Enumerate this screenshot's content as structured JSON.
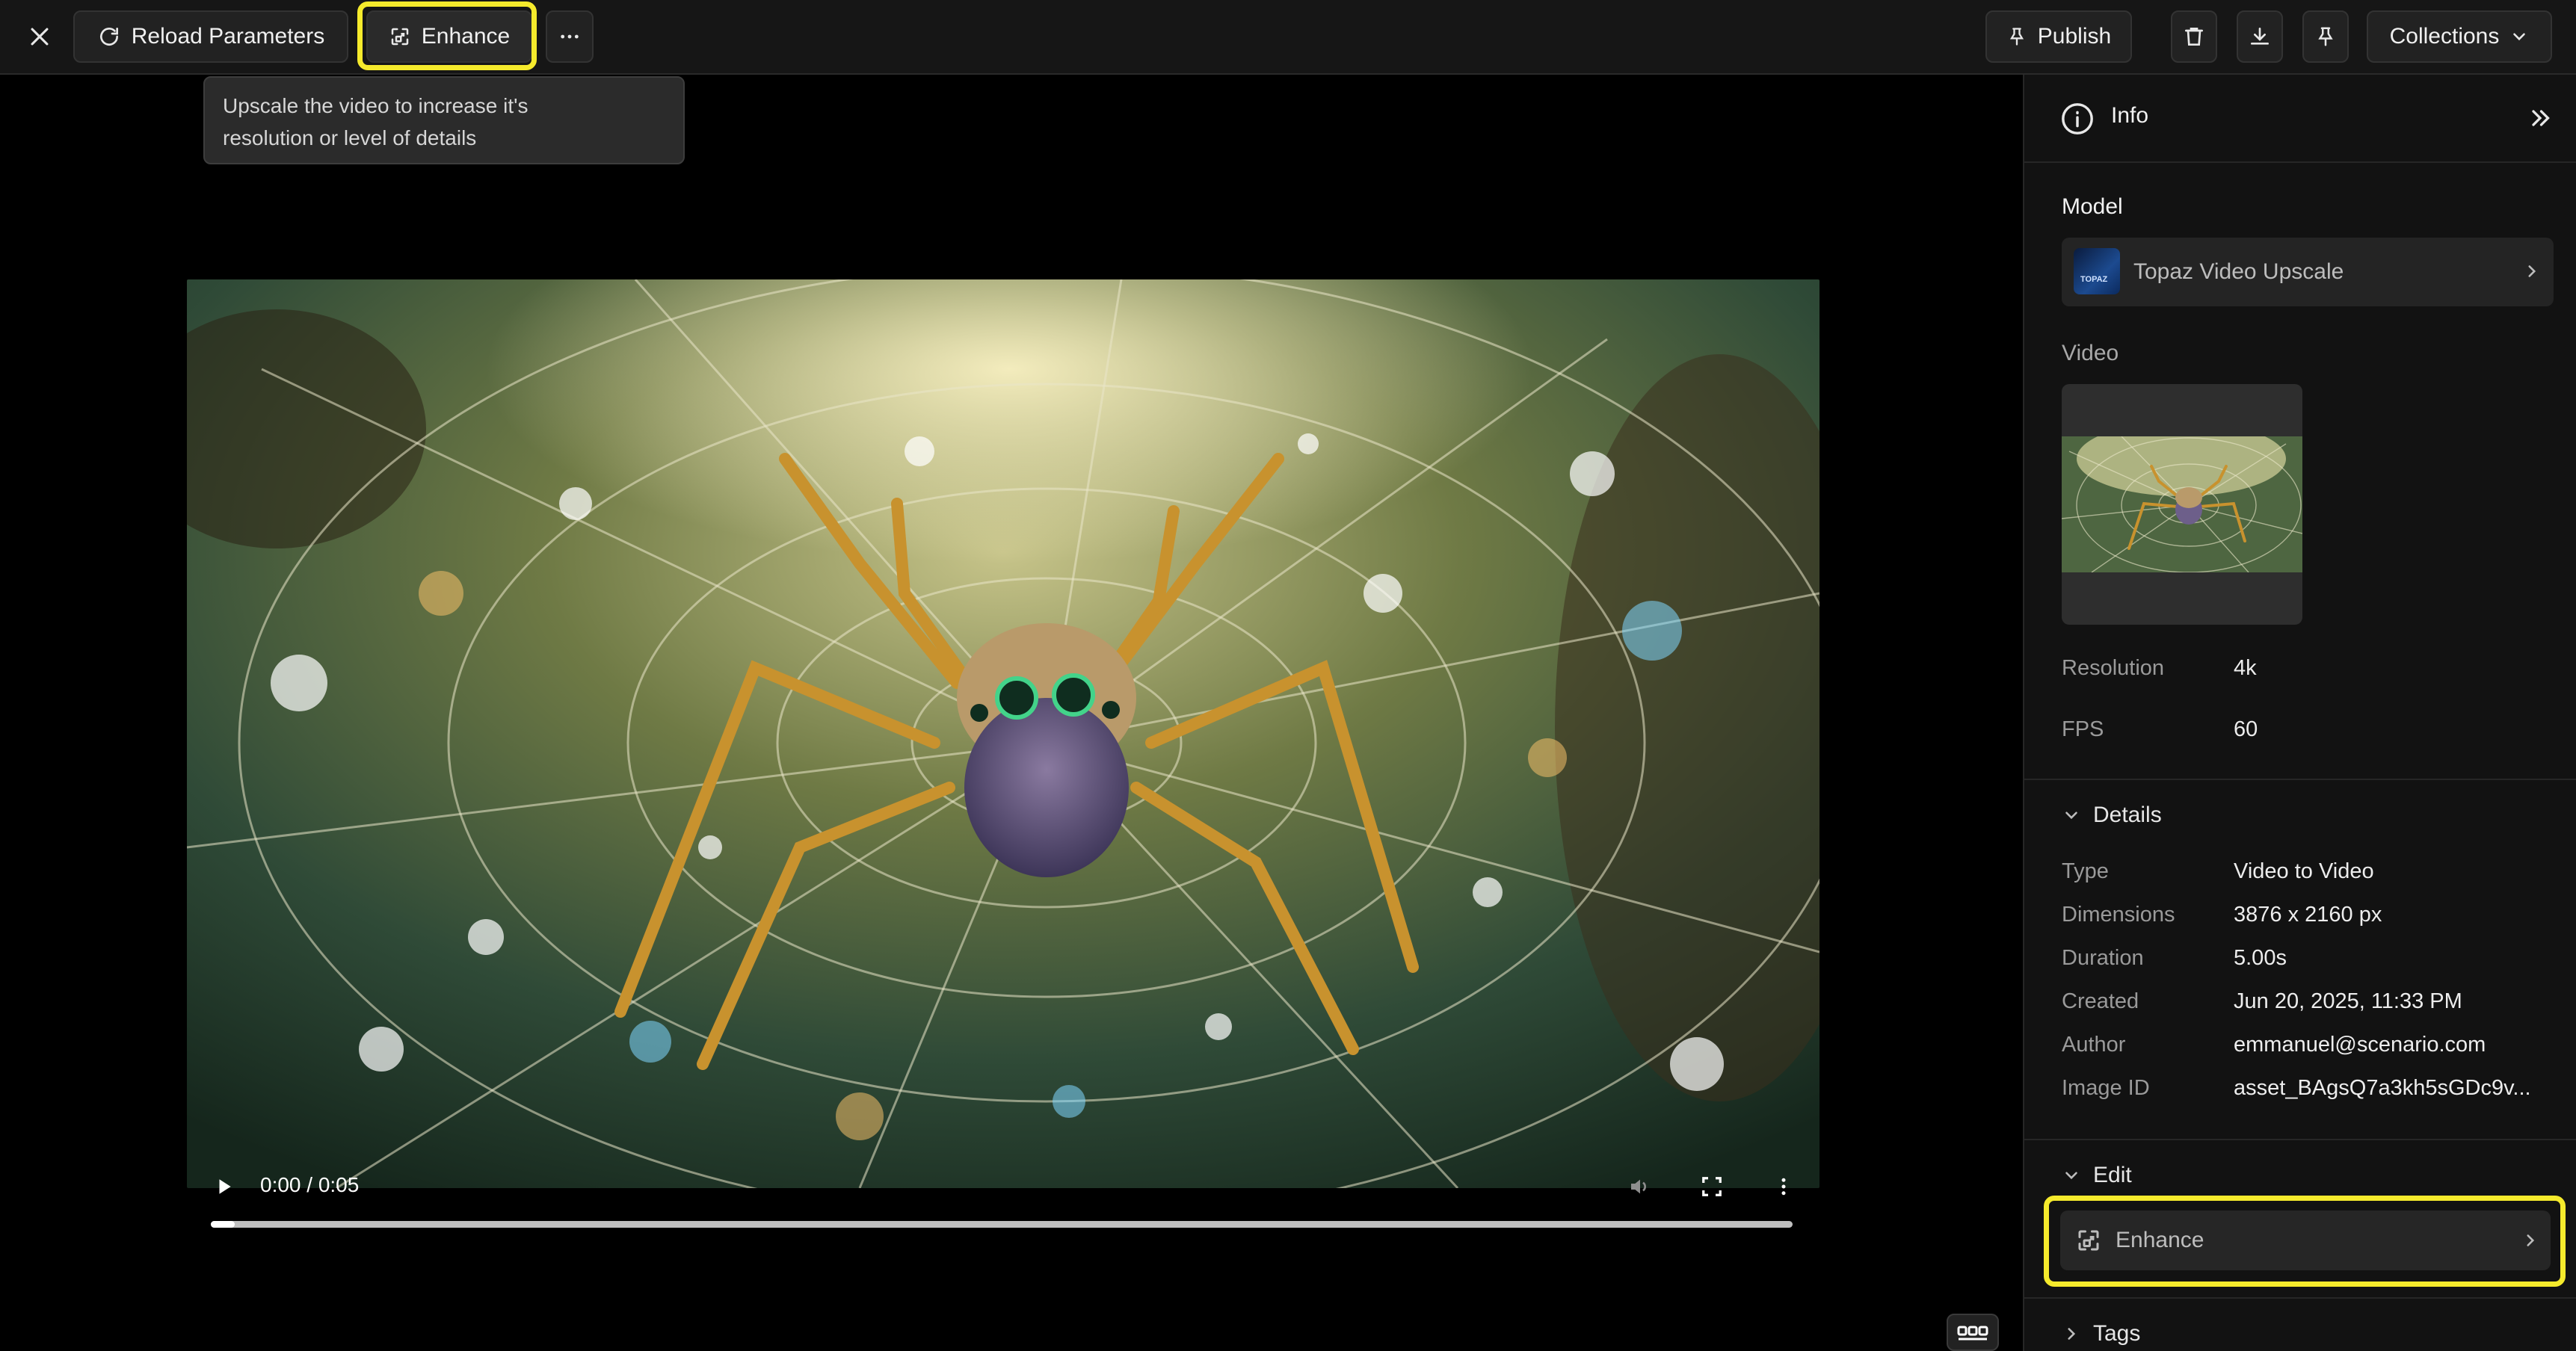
{
  "topbar": {
    "reload_label": "Reload Parameters",
    "enhance_label": "Enhance",
    "publish_label": "Publish",
    "collections_label": "Collections"
  },
  "tooltip": {
    "line1": "Upscale the video to increase it's",
    "line2": "resolution or level of details"
  },
  "player": {
    "time": "0:00 / 0:05",
    "progress_fraction": 0.015
  },
  "panel": {
    "header": "Info",
    "model_section": "Model",
    "model_name": "Topaz Video Upscale",
    "model_logo_text": "TOPAZ",
    "video_section": "Video",
    "resolution_label": "Resolution",
    "resolution_value": "4k",
    "fps_label": "FPS",
    "fps_value": "60",
    "details_title": "Details",
    "details": [
      {
        "label": "Type",
        "value": "Video to Video"
      },
      {
        "label": "Dimensions",
        "value": "3876 x 2160 px"
      },
      {
        "label": "Duration",
        "value": "5.00s"
      },
      {
        "label": "Created",
        "value": "Jun 20, 2025, 11:33 PM"
      },
      {
        "label": "Author",
        "value": "emmanuel@scenario.com"
      },
      {
        "label": "Image ID",
        "value": "asset_BAgsQ7a3kh5sGDc9v..."
      }
    ],
    "edit_title": "Edit",
    "edit_enhance_label": "Enhance",
    "tags_title": "Tags"
  },
  "colors": {
    "highlight": "#f5ea2c",
    "panel_bg": "#121212",
    "topbar_bg": "#161616"
  }
}
